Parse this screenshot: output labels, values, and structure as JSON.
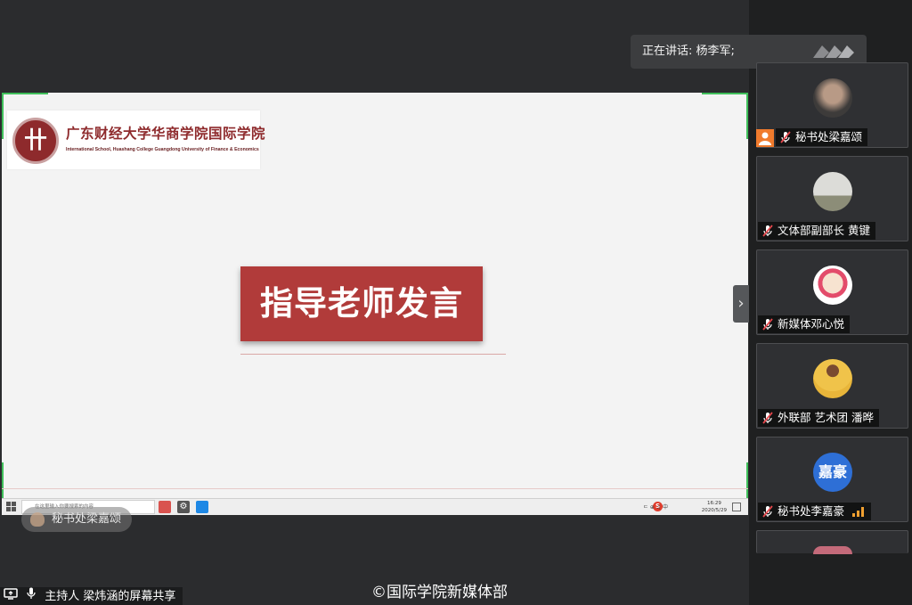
{
  "meeting": {
    "speaking_label": "正在讲话: 杨李军;",
    "share_status": "主持人 梁炜涵的屏幕共享",
    "watermark": "©国际学院新媒体部",
    "presenter_chip": "秘书处梁嘉颂"
  },
  "slide": {
    "logo_cn": "广东财经大学华商学院国际学院",
    "logo_en": "International School, Huashang College Guangdong University of Finance & Economics",
    "title": "指导老师发言"
  },
  "taskbar": {
    "search_placeholder": "在这里输入你要搜索的内容",
    "tray_text": "ㄷ  ⊕  ♫ 中",
    "tray_s": "S",
    "time": "16:29",
    "date": "2020/5/29"
  },
  "participants": [
    {
      "name": "秘书处梁嘉颂",
      "avatar": "photo-portrait",
      "host": true
    },
    {
      "name": "文体部副部长 黄键",
      "avatar": "photo-landscape",
      "host": false
    },
    {
      "name": "新媒体邓心悦",
      "avatar": "photo-cartoon",
      "host": false
    },
    {
      "name": "外联部 艺术团 潘晔",
      "avatar": "photo-basketball",
      "host": false
    },
    {
      "name": "秘书处李嘉豪",
      "avatar_text": "嘉豪",
      "avatar_color": "#2e6fd6",
      "host": false,
      "speaking": true
    }
  ],
  "colors": {
    "banner": "#b13b3a",
    "accent_green": "#3fbf5a",
    "host_orange": "#f07b2d",
    "mic_red": "#e5484d",
    "signal_orange": "#f0a030"
  },
  "icons": {
    "side_arrow": "chevron-right-icon",
    "mic_off": "mic-off-icon",
    "share": "screen-share-icon",
    "mic": "mic-icon"
  }
}
